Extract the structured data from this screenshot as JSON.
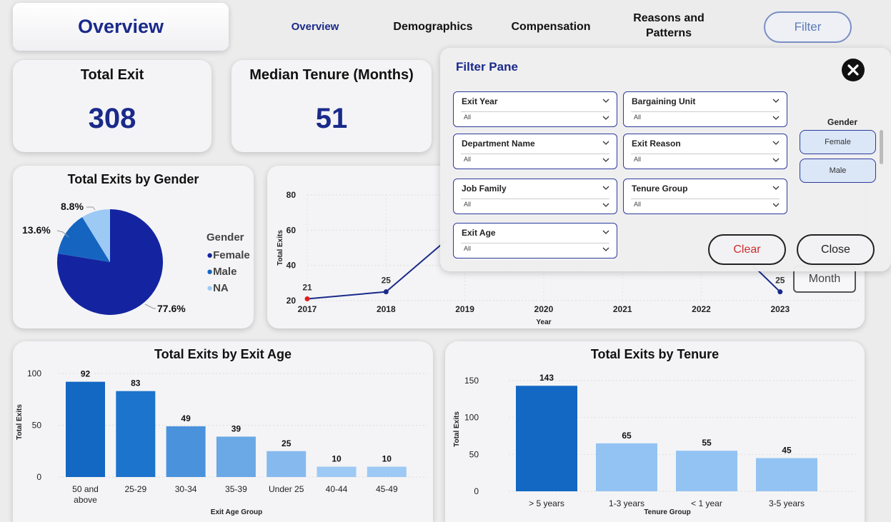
{
  "header": {
    "title": "Overview",
    "nav": [
      {
        "label": "Overview"
      },
      {
        "label": "Demographics"
      },
      {
        "label": "Compensation"
      },
      {
        "label": "Reasons and Patterns"
      }
    ],
    "filter_label": "Filter"
  },
  "kpis": {
    "total_exit": {
      "label": "Total Exit",
      "value": "308"
    },
    "median_tenure": {
      "label": "Median Tenure (Months)",
      "value": "51"
    }
  },
  "colors": {
    "accent": "#1a2a8a",
    "female": "#1424a0",
    "male": "#1565c0",
    "na": "#9ccaf5",
    "bar_dark": "#1368c3",
    "bar_mid": "#4a93dc",
    "bar_light": "#93c3f2"
  },
  "gender_chart": {
    "legend_title": "Gender",
    "legend": [
      "Female",
      "Male",
      "NA"
    ]
  },
  "year_chart": {
    "time_buttons": [
      "Month"
    ]
  },
  "filter_pane": {
    "title": "Filter Pane",
    "slicers": [
      {
        "label": "Exit Year",
        "value": "All"
      },
      {
        "label": "Bargaining Unit",
        "value": "All"
      },
      {
        "label": "Department Name",
        "value": "All"
      },
      {
        "label": "Exit Reason",
        "value": "All"
      },
      {
        "label": "Job Family",
        "value": "All"
      },
      {
        "label": "Tenure Group",
        "value": "All"
      },
      {
        "label": "Exit Age",
        "value": "All"
      }
    ],
    "gender_label": "Gender",
    "gender_options": [
      "Female",
      "Male"
    ],
    "clear_label": "Clear",
    "close_label": "Close"
  },
  "chart_data": [
    {
      "type": "pie",
      "title": "Total Exits by Gender",
      "categories": [
        "Female",
        "Male",
        "NA"
      ],
      "values": [
        77.6,
        13.6,
        8.8
      ],
      "labels": [
        "77.6%",
        "13.6%",
        "8.8%"
      ],
      "legend": "right"
    },
    {
      "type": "line",
      "title": "",
      "xlabel": "Year",
      "ylabel": "Total Exits",
      "x": [
        "2017",
        "2018",
        "2019",
        "2020",
        "2021",
        "2022",
        "2023"
      ],
      "yticks": [
        "20",
        "40",
        "60",
        "80"
      ],
      "ylim": [
        20,
        80
      ],
      "visible_points": [
        {
          "x": "2017",
          "y": 21
        },
        {
          "x": "2018",
          "y": 25
        },
        {
          "x": "2023",
          "y": 25
        }
      ],
      "grid": true
    },
    {
      "type": "bar",
      "title": "Total Exits by Exit Age",
      "xlabel": "Exit Age Group",
      "ylabel": "Total Exits",
      "categories": [
        "50 and above",
        "25-29",
        "30-34",
        "35-39",
        "Under 25",
        "40-44",
        "45-49"
      ],
      "values": [
        92,
        83,
        49,
        39,
        25,
        10,
        10
      ],
      "yticks": [
        "0",
        "50",
        "100"
      ],
      "ylim": [
        0,
        100
      ]
    },
    {
      "type": "bar",
      "title": "Total Exits by Tenure",
      "xlabel": "Tenure Group",
      "ylabel": "Total Exits",
      "categories": [
        "> 5 years",
        "1-3 years",
        "< 1 year",
        "3-5 years"
      ],
      "values": [
        143,
        65,
        55,
        45
      ],
      "yticks": [
        "0",
        "50",
        "100",
        "150"
      ],
      "ylim": [
        0,
        150
      ]
    }
  ]
}
